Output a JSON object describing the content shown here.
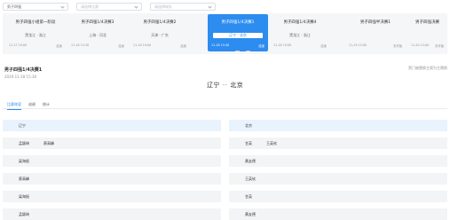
{
  "filters": [
    {
      "text": "男子四强",
      "placeholder": false
    },
    {
      "text": "请选择比赛",
      "placeholder": true
    },
    {
      "text": "请选择球队",
      "placeholder": true
    }
  ],
  "carousel": {
    "cards": [
      {
        "title": "男子四强小组第一阶段",
        "matchup": "黑龙江 · 浙江",
        "time": "11-17 19:00",
        "status": "结束",
        "active": false
      },
      {
        "title": "男子四强1/4决赛3",
        "matchup": "上海 · 河北",
        "time": "11-18 15:30",
        "status": "结束",
        "active": false
      },
      {
        "title": "男子四强1/4决赛2",
        "matchup": "天津 · 广东",
        "time": "11-18 19:00",
        "status": "结束",
        "active": false
      },
      {
        "title": "男子四强1/4决赛1",
        "matchup": "辽宁 · 北京",
        "time": "11-18 15:30",
        "status": "结束",
        "active": true
      },
      {
        "title": "男子四强1/4决赛4",
        "matchup": "黑龙江 · 浙江",
        "time": "11-18 19:00",
        "status": "结束",
        "active": false
      },
      {
        "title": "男子四强半决赛1",
        "matchup": "",
        "time": "11-19 15:00",
        "status": "未开始",
        "active": false
      },
      {
        "title": "男子四强决赛",
        "matchup": "",
        "time": "11-20 15:00",
        "status": "未开始",
        "active": false
      }
    ]
  },
  "match": {
    "title": "男子四强1/4决赛1",
    "date": "2020-11-18 15:30",
    "legend": "黑门被替换主视为主替换",
    "home": "辽宁",
    "separator": "--",
    "away": "北京"
  },
  "tabs": [
    {
      "label": "比赛阵容",
      "active": true
    },
    {
      "label": "成绩",
      "active": false
    },
    {
      "label": "统计",
      "active": false
    }
  ],
  "lineup": {
    "left": [
      {
        "p1": "辽宁",
        "p2": "",
        "head": true
      },
      {
        "p1": "孟颖琦",
        "p2": "蔡高峰",
        "head": false
      },
      {
        "p1": "梁海振",
        "p2": "",
        "head": false
      },
      {
        "p1": "蔡高峰",
        "p2": "",
        "head": false
      },
      {
        "p1": "梁海振",
        "p2": "",
        "head": false
      },
      {
        "p1": "孟颖琦",
        "p2": "",
        "head": false
      }
    ],
    "right": [
      {
        "p1": "北京",
        "p2": "",
        "head": true
      },
      {
        "p1": "甘英",
        "p2": "王英钦",
        "head": false
      },
      {
        "p1": "黄友德",
        "p2": "",
        "head": false
      },
      {
        "p1": "王英钦",
        "p2": "",
        "head": false
      },
      {
        "p1": "甘英",
        "p2": "",
        "head": false
      },
      {
        "p1": "黄友德",
        "p2": "",
        "head": false
      }
    ]
  }
}
